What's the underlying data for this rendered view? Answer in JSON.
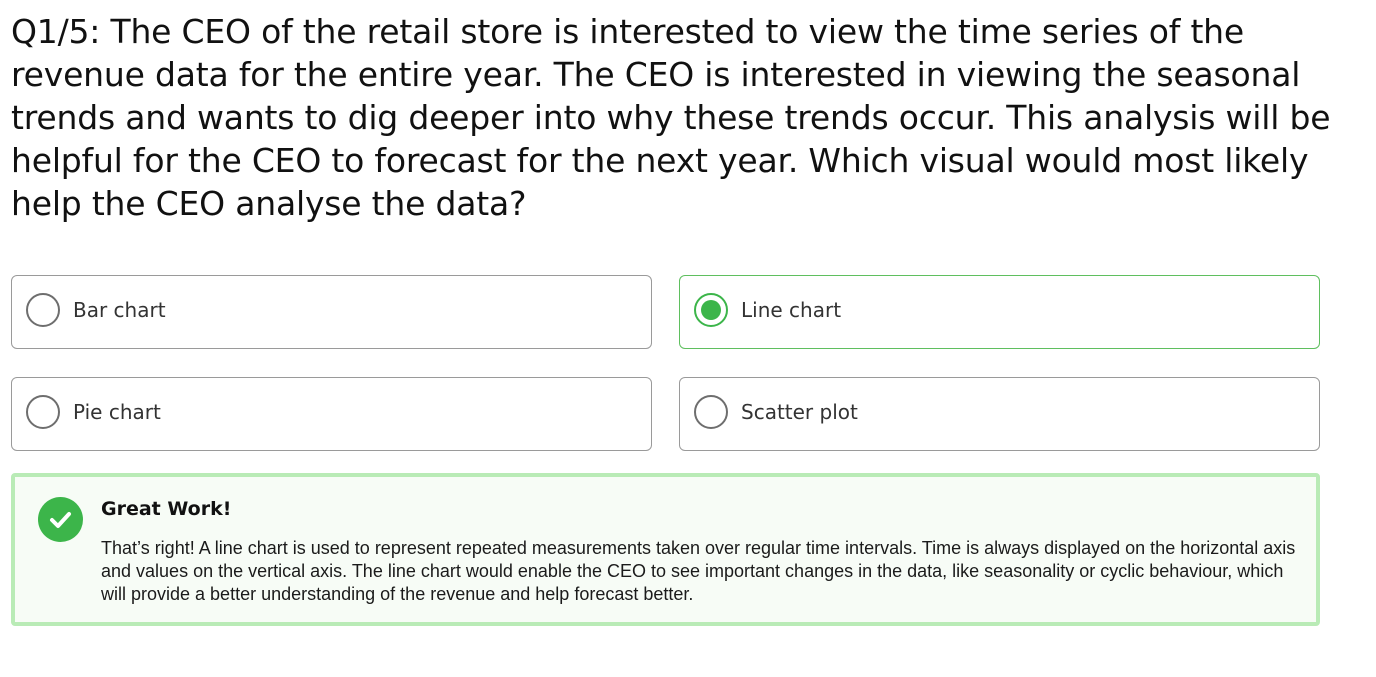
{
  "question": {
    "text": "Q1/5: The CEO of the retail store is interested to view the time series of the revenue data for the entire year. The CEO is interested in viewing the seasonal trends and wants to dig deeper into why these trends occur. This analysis will be helpful for the CEO to forecast for the next year. Which visual would most likely help the CEO analyse the data?"
  },
  "options": [
    {
      "label": "Bar chart",
      "selected": false
    },
    {
      "label": "Line chart",
      "selected": true
    },
    {
      "label": "Pie chart",
      "selected": false
    },
    {
      "label": "Scatter plot",
      "selected": false
    }
  ],
  "feedback": {
    "icon": "check-circle-icon",
    "title": "Great Work!",
    "body": "That’s right! A line chart is used to represent repeated measurements taken over regular time intervals. Time is always displayed on the horizontal axis and values on the vertical axis. The line chart would enable the CEO to see important changes in the data, like seasonality or cyclic behaviour, which will provide a better understanding of the revenue and help forecast better."
  },
  "colors": {
    "correct_green": "#3cb54a",
    "feedback_border": "#b9ebb6",
    "feedback_bg": "#f7fcf6"
  }
}
